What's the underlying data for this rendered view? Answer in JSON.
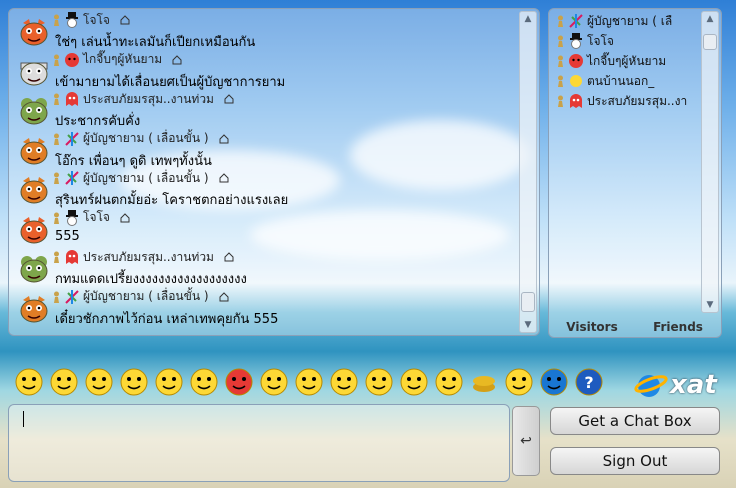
{
  "messages": [
    {
      "name": "",
      "text": "ใช่ๆ เล่นน้ำทะเลมันก็เปียกเหมือนกัน",
      "avatar": "garfield-avatar",
      "icon": "top-hat-snowman-icon",
      "color": "#e9602b"
    },
    {
      "name": "ไกจี๊บๆผู้หันยาม",
      "text": "เข้ามายามได้เลื่อนยศเป็นผู้บัญชาการยาม",
      "avatar": "cow-avatar",
      "icon": "red-face-icon",
      "color": "#dddddd"
    },
    {
      "name": "ประสบภัยมรสุม..งานท่วม",
      "text": "ประชากรคับคั่ง",
      "avatar": "frog-avatar",
      "icon": "red-ghost-icon",
      "color": "#7ea64b"
    },
    {
      "name": "ผู้บัญชายาม  ( เลื่อนขั้น )",
      "text": "โอ๊กร เพื่อนๆ ดูดิ เทพๆทั้งนั้น",
      "avatar": "tiger-avatar",
      "icon": "feather-icon",
      "color": "#e07d26"
    },
    {
      "name": "ผู้บัญชายาม  ( เลื่อนขั้น )",
      "text": "สุรินทร์ฝนตกมั้ยอ่ะ โคราชตกอย่างแรงเลย",
      "avatar": "tiger-avatar",
      "icon": "feather-icon",
      "color": "#e07d26"
    },
    {
      "name": "",
      "text": "555",
      "avatar": "garfield-avatar",
      "icon": "top-hat-snowman-icon",
      "color": "#e9602b"
    },
    {
      "name": "ประสบภัยมรสุม..งานท่วม",
      "text": "กทมแดดเปรี้ยงงงงงงงงงงงงงงงงงง",
      "avatar": "frog-avatar",
      "icon": "red-ghost-icon",
      "color": "#7ea64b"
    },
    {
      "name": "ผู้บัญชายาม  ( เลื่อนขั้น )",
      "text": "เดี๋ยวชักภาพไว้ก่อน เหล่าเทพคุยกัน 555",
      "avatar": "tiger-avatar",
      "icon": "feather-icon",
      "color": "#e07d26"
    }
  ],
  "special_names": {
    "jojo": "โจโจ"
  },
  "users": [
    {
      "name": "ผู้บัญชายาม  ( เลื",
      "icon": "feather-icon"
    },
    {
      "name": "โจโจ",
      "icon": "top-hat-snowman-icon"
    },
    {
      "name": "ไกจี๊บๆผู้หันยาม",
      "icon": "red-face-icon"
    },
    {
      "name": "ตนบ้านนอก_",
      "icon": "sun-icon"
    },
    {
      "name": "ประสบภัยมรสุม..งา",
      "icon": "red-ghost-icon"
    }
  ],
  "tabs": {
    "visitors": "Visitors",
    "friends": "Friends"
  },
  "buttons": {
    "get_chat_box": "Get a Chat Box",
    "sign_out": "Sign Out",
    "send": "↩"
  },
  "brand": {
    "logo_text": "xat"
  },
  "smileys": [
    "smile",
    "biggrin",
    "wink",
    "eek",
    "tongue",
    "cool",
    "mad",
    "confused",
    "redface",
    "frown",
    "crying",
    "content",
    "love",
    "coins",
    "no-sound",
    "group",
    "help"
  ]
}
